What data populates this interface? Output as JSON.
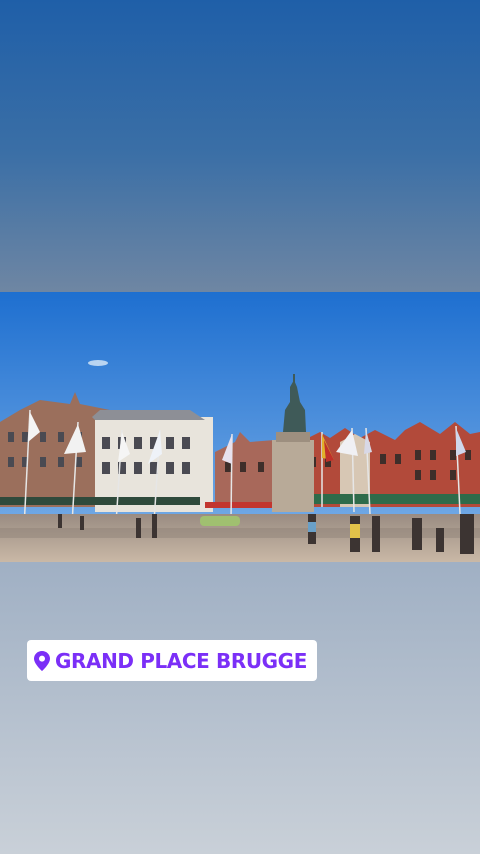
{
  "story": {
    "location_sticker": {
      "text": "GRAND PLACE BRUGGE",
      "icon": "location-pin-icon",
      "color": "#7b2ff7",
      "background": "#ffffff"
    },
    "photo": {
      "subject": "market-square-photo",
      "sky_color": "#2f7fd8"
    },
    "background_gradient": [
      "#1f5fa8",
      "#c9d0d8"
    ]
  }
}
